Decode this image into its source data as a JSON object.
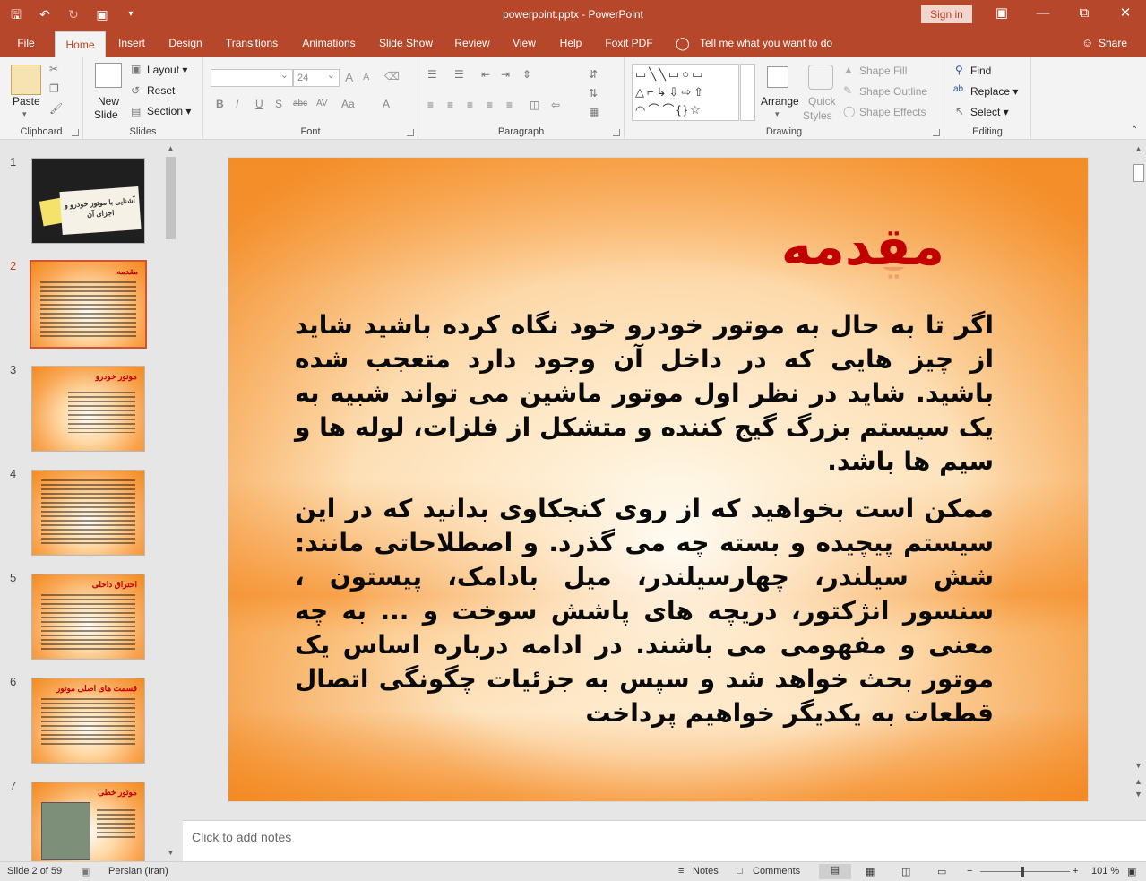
{
  "app": {
    "title": "powerpoint.pptx  -  PowerPoint",
    "signin": "Sign in",
    "accent": "#b7472a"
  },
  "tabs": [
    {
      "label": "File"
    },
    {
      "label": "Home"
    },
    {
      "label": "Insert"
    },
    {
      "label": "Design"
    },
    {
      "label": "Transitions"
    },
    {
      "label": "Animations"
    },
    {
      "label": "Slide Show"
    },
    {
      "label": "Review"
    },
    {
      "label": "View"
    },
    {
      "label": "Help"
    },
    {
      "label": "Foxit PDF"
    }
  ],
  "tellme": "Tell me what you want to do",
  "share": "Share",
  "ribbon": {
    "clipboard": {
      "paste": "Paste",
      "label": "Clipboard"
    },
    "slides": {
      "new_slide_1": "New",
      "new_slide_2": "Slide",
      "layout": "Layout",
      "reset": "Reset",
      "section": "Section",
      "label": "Slides"
    },
    "font": {
      "size": "24",
      "label": "Font"
    },
    "paragraph": {
      "label": "Paragraph"
    },
    "drawing": {
      "arrange": "Arrange",
      "quick_styles_1": "Quick",
      "quick_styles_2": "Styles",
      "shape_fill": "Shape Fill",
      "shape_outline": "Shape Outline",
      "shape_effects": "Shape Effects",
      "label": "Drawing"
    },
    "editing": {
      "find": "Find",
      "replace": "Replace",
      "select": "Select",
      "label": "Editing"
    }
  },
  "thumbnails": [
    {
      "num": "1",
      "title": "آشنایی با موتور خودرو و اجزای آن"
    },
    {
      "num": "2",
      "title": "مقدمه"
    },
    {
      "num": "3",
      "title": "موتور خودرو"
    },
    {
      "num": "4",
      "title": ""
    },
    {
      "num": "5",
      "title": "احتراق داخلی"
    },
    {
      "num": "6",
      "title": "قسمت های اصلی موتور"
    },
    {
      "num": "7",
      "title": "موتور خطی"
    }
  ],
  "slide": {
    "title": "مقدمه",
    "paragraph1": "اگر تا به حال به موتور خودرو خود نگاه کرده باشید شاید از چیز هایی که در داخل آن وجود دارد متعجب شده باشید. شاید در نظر اول موتور ماشین می تواند شبیه به یک سیستم بزرگ گیج کننده و متشکل از فلزات، لوله ها و سیم ها باشد.",
    "paragraph2": "ممکن است بخواهید که از روی کنجکاوی بدانید که در این سیستم پیچیده و بسته چه می گذرد. و اصطلاحاتی مانند: شش سیلندر، چهارسیلندر، میل بادامک، پیستون ، سنسور انژکتور، دریچه های پاشش سوخت و ... به چه معنی و مفهومی می باشند. در ادامه درباره اساس یک موتور بحث خواهد شد و سپس به جزئیات چگونگی اتصال قطعات به یکدیگر خواهیم پرداخت"
  },
  "notes": {
    "placeholder": "Click to add notes"
  },
  "status": {
    "slide": "Slide 2 of 59",
    "language": "Persian (Iran)",
    "notes": "Notes",
    "comments": "Comments",
    "zoom": "101 %"
  }
}
